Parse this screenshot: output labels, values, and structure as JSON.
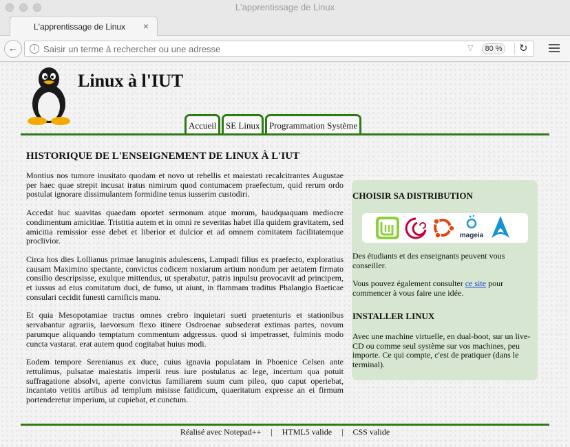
{
  "window": {
    "title": "L'apprentissage de Linux"
  },
  "tab": {
    "label": "L'apprentissage de Linux",
    "close": "×",
    "new_tab": "+"
  },
  "navbar": {
    "back": "←",
    "url_placeholder": "Saisir un terme à rechercher ou une adresse",
    "zoom": "80 %",
    "reload": "↻"
  },
  "header": {
    "title": "Linux à l'IUT"
  },
  "menu": [
    "Accueil",
    "SE Linux",
    "Programmation Système"
  ],
  "main": {
    "title": "HISTORIQUE DE L'ENSEIGNEMENT DE LINUX À L'IUT",
    "paragraphs": [
      "Montius nos tumore inusitato quodam et novo ut rebellis et maiestati recalcitrantes Augustae per haec quae strepit incusat iratus nimirum quod contumacem praefectum, quid rerum ordo postulat ignorare dissimulantem formidine tenus iusserim custodiri.",
      "Accedat huc suavitas quaedam oportet sermonum atque morum, haudquaquam mediocre condimentum amicitiae. Tristitia autem et in omni re severitas habet illa quidem gravitatem, sed amicitia remissior esse debet et liberior et dulcior et ad omnem comitatem facilitatemque proclivior.",
      "Circa hos dies Lollianus primae lanuginis adulescens, Lampadi filius ex praefecto, exploratius causam Maximino spectante, convictus codicem noxiarum artium nondum per aetatem firmato consilio descripsisse, exulque mittendus, ut sperabatur, patris inpulsu provocavit ad principem, et iussus ad eius comitatum duci, de fumo, ut aiunt, in flammam traditus Phalangio Baeticae consulari cecidit funesti carnificis manu.",
      "Et quia Mesopotamiae tractus omnes crebro inquietari sueti praetenturis et stationibus servabantur agrariis, laevorsum flexo itinere Osdroenae subsederat extimas partes, novum parumque aliquando temptatum commentum adgressus. quod si impetrasset, fulminis modo cuncta vastarat. erat autem quod cogitabat huius modi.",
      "Eodem tempore Serenianus ex duce, cuius ignavia populatam in Phoenice Celsen ante rettulimus, pulsatae maiestatis imperii reus iure postulatus ac lege, incertum qua potuit suffragatione absolvi, aperte convictus familiarem suum cum pileo, quo caput operiebat, incantato vetitis artibus ad templum misisse fatidicum, quaeritatum expresse an ei firmum portenderetur imperium, ut cupiebat, et cunctum."
    ]
  },
  "aside": {
    "distro_title": "CHOISIR SA DISTRIBUTION",
    "distro_logos": [
      "mint-logo",
      "debian-logo",
      "ubuntu-logo",
      "mageia-logo",
      "arch-logo"
    ],
    "mageia_text": "mageia",
    "p1": "Des étudiants et des enseignants peuvent vous conseiller.",
    "p2_before": "Vous pouvez également consulter ",
    "p2_link": "ce site",
    "p2_after": " pour commencer à vous faire une idée.",
    "install_title": "INSTALLER LINUX",
    "p3": "Avec une machine virtuelle, en dual-boot, sur un live-CD ou comme seul système sur vos machines, peu importe. Ce qui compte, c'est de pratiquer (dans le terminal)."
  },
  "footer": {
    "items": [
      "Réalisé avec Notepad++",
      "HTML5 valide",
      "CSS valide"
    ],
    "separator": "|"
  },
  "colors": {
    "accent_green": "#2e7a14",
    "aside_bg": "#d6e6d0",
    "link": "#1a3fd6"
  }
}
